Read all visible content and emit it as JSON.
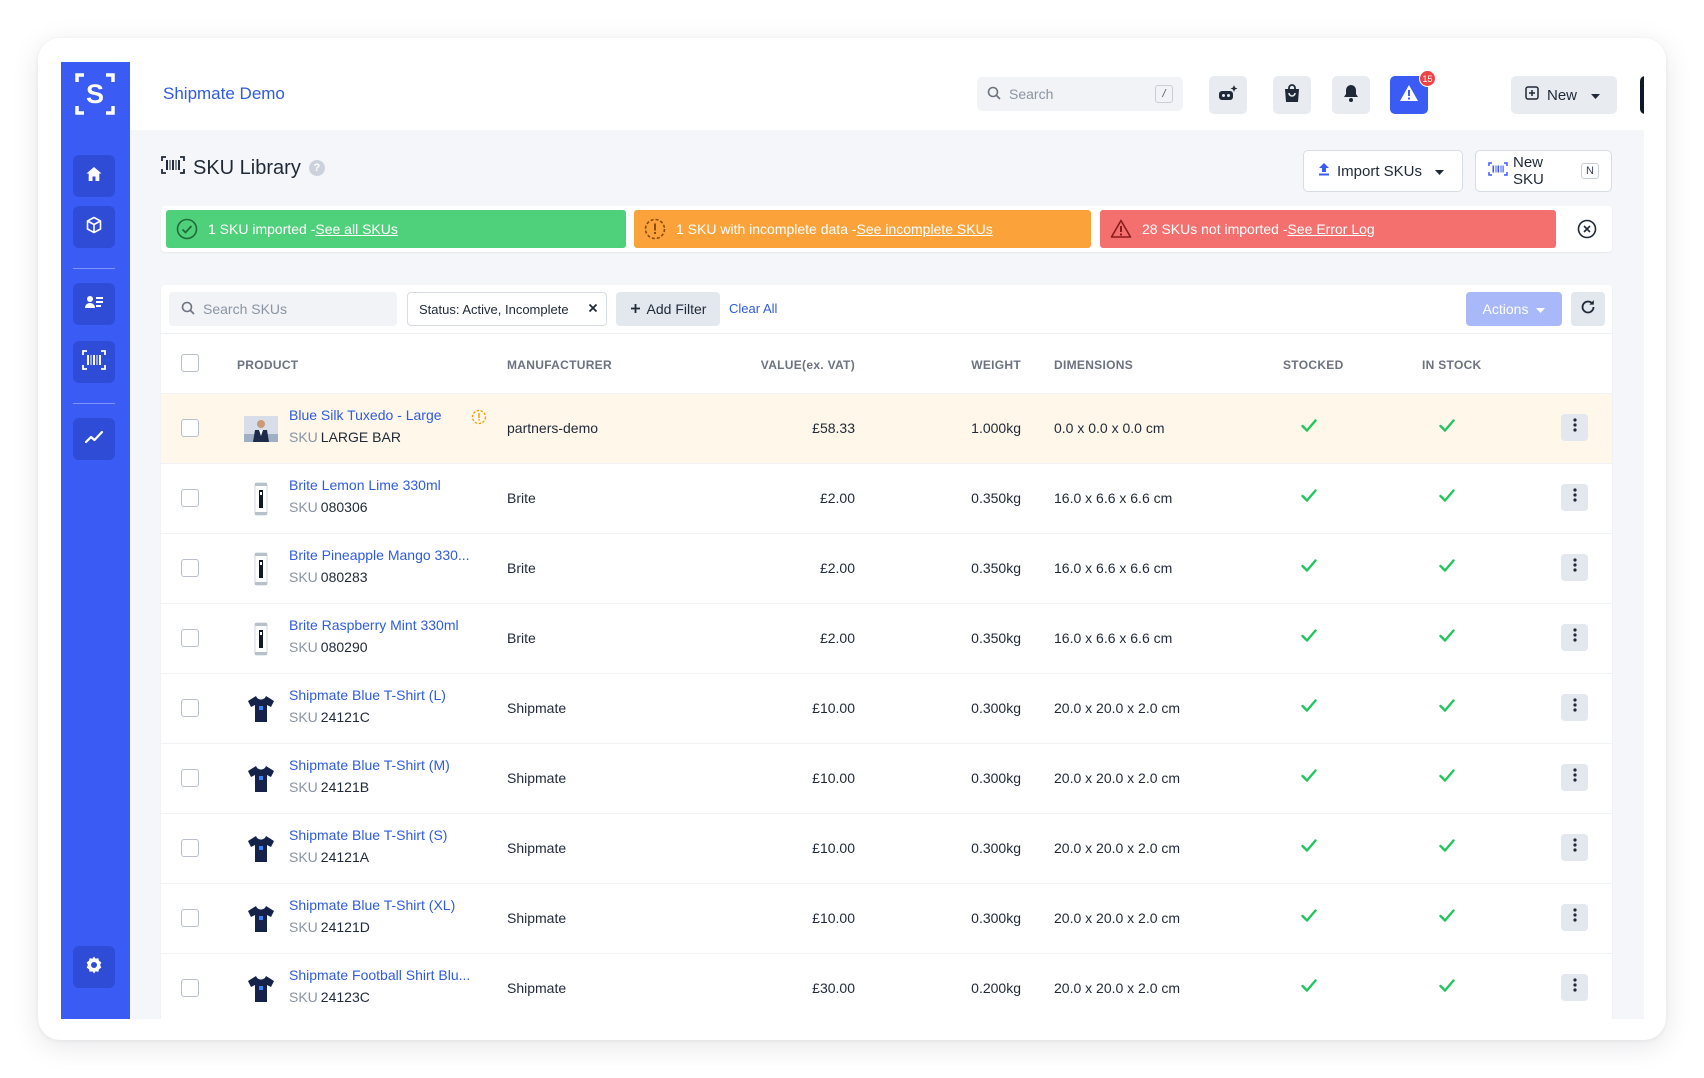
{
  "app": {
    "title": "Shipmate Demo"
  },
  "topbar": {
    "search_placeholder": "Search",
    "search_shortcut": "/",
    "alert_count": "15",
    "new_label": "New"
  },
  "page": {
    "title": "SKU Library",
    "help": "?",
    "import_label": "Import SKUs",
    "new_sku_label": "New SKU",
    "new_sku_shortcut": "N"
  },
  "banners": [
    {
      "text": "1 SKU imported - ",
      "link": "See all SKUs",
      "color": "#4fd07a"
    },
    {
      "text": "1 SKU with incomplete data - ",
      "link": "See incomplete SKUs",
      "color": "#fba23a"
    },
    {
      "text": "28 SKUs not imported - ",
      "link": "See Error Log",
      "color": "#f4706f"
    }
  ],
  "toolbar": {
    "search_placeholder": "Search SKUs",
    "filter_chip": "Status: Active, Incomplete",
    "add_filter": "Add Filter",
    "clear_all": "Clear All",
    "actions": "Actions"
  },
  "columns": {
    "product": "PRODUCT",
    "manufacturer": "MANUFACTURER",
    "value": "VALUE(ex. VAT)",
    "weight": "WEIGHT",
    "dimensions": "DIMENSIONS",
    "stocked": "STOCKED",
    "in_stock": "IN STOCK"
  },
  "sku_label": "SKU",
  "rows": [
    {
      "name": "Blue Silk Tuxedo - Large",
      "sku": "LARGE BAR",
      "manufacturer": "partners-demo",
      "value": "£58.33",
      "weight": "1.000kg",
      "dimensions": "0.0 x 0.0 x 0.0 cm",
      "stocked": true,
      "in_stock": true,
      "thumb": "tuxedo",
      "warning": true
    },
    {
      "name": "Brite Lemon Lime 330ml",
      "sku": "080306",
      "manufacturer": "Brite",
      "value": "£2.00",
      "weight": "0.350kg",
      "dimensions": "16.0 x 6.6 x 6.6 cm",
      "stocked": true,
      "in_stock": true,
      "thumb": "can"
    },
    {
      "name": "Brite Pineapple Mango 330...",
      "sku": "080283",
      "manufacturer": "Brite",
      "value": "£2.00",
      "weight": "0.350kg",
      "dimensions": "16.0 x 6.6 x 6.6 cm",
      "stocked": true,
      "in_stock": true,
      "thumb": "can"
    },
    {
      "name": "Brite Raspberry Mint 330ml",
      "sku": "080290",
      "manufacturer": "Brite",
      "value": "£2.00",
      "weight": "0.350kg",
      "dimensions": "16.0 x 6.6 x 6.6 cm",
      "stocked": true,
      "in_stock": true,
      "thumb": "can"
    },
    {
      "name": "Shipmate Blue T-Shirt (L)",
      "sku": "24121C",
      "manufacturer": "Shipmate",
      "value": "£10.00",
      "weight": "0.300kg",
      "dimensions": "20.0 x 20.0 x 2.0 cm",
      "stocked": true,
      "in_stock": true,
      "thumb": "tshirt"
    },
    {
      "name": "Shipmate Blue T-Shirt (M)",
      "sku": "24121B",
      "manufacturer": "Shipmate",
      "value": "£10.00",
      "weight": "0.300kg",
      "dimensions": "20.0 x 20.0 x 2.0 cm",
      "stocked": true,
      "in_stock": true,
      "thumb": "tshirt"
    },
    {
      "name": "Shipmate Blue T-Shirt (S)",
      "sku": "24121A",
      "manufacturer": "Shipmate",
      "value": "£10.00",
      "weight": "0.300kg",
      "dimensions": "20.0 x 20.0 x 2.0 cm",
      "stocked": true,
      "in_stock": true,
      "thumb": "tshirt"
    },
    {
      "name": "Shipmate Blue T-Shirt (XL)",
      "sku": "24121D",
      "manufacturer": "Shipmate",
      "value": "£10.00",
      "weight": "0.300kg",
      "dimensions": "20.0 x 20.0 x 2.0 cm",
      "stocked": true,
      "in_stock": true,
      "thumb": "tshirt"
    },
    {
      "name": "Shipmate Football Shirt Blu...",
      "sku": "24123C",
      "manufacturer": "Shipmate",
      "value": "£30.00",
      "weight": "0.200kg",
      "dimensions": "20.0 x 20.0 x 2.0 cm",
      "stocked": true,
      "in_stock": true,
      "thumb": "tshirt"
    }
  ],
  "colors": {
    "brand": "#3b5bf5",
    "link": "#2f5be0",
    "check": "#22c55e",
    "row_highlight": "#fef7ea"
  }
}
